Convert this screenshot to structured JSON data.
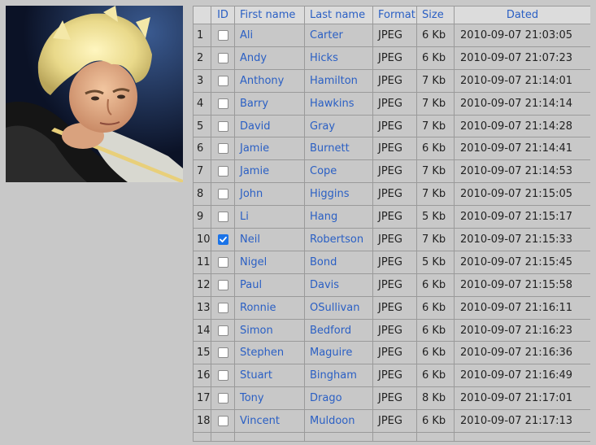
{
  "photo": {
    "subject": "snooker-player-photo"
  },
  "table": {
    "columns": [
      "",
      "ID",
      "First name",
      "Last name",
      "Format",
      "Size",
      "Dated"
    ],
    "rows": [
      {
        "num": "1",
        "checked": false,
        "first": "Ali",
        "last": "Carter",
        "format": "JPEG",
        "size": "6 Kb",
        "dated": "2010-09-07 21:03:05"
      },
      {
        "num": "2",
        "checked": false,
        "first": "Andy",
        "last": "Hicks",
        "format": "JPEG",
        "size": "6 Kb",
        "dated": "2010-09-07 21:07:23"
      },
      {
        "num": "3",
        "checked": false,
        "first": "Anthony",
        "last": "Hamilton",
        "format": "JPEG",
        "size": "7 Kb",
        "dated": "2010-09-07 21:14:01"
      },
      {
        "num": "4",
        "checked": false,
        "first": "Barry",
        "last": "Hawkins",
        "format": "JPEG",
        "size": "7 Kb",
        "dated": "2010-09-07 21:14:14"
      },
      {
        "num": "5",
        "checked": false,
        "first": "David",
        "last": "Gray",
        "format": "JPEG",
        "size": "7 Kb",
        "dated": "2010-09-07 21:14:28"
      },
      {
        "num": "6",
        "checked": false,
        "first": "Jamie",
        "last": "Burnett",
        "format": "JPEG",
        "size": "6 Kb",
        "dated": "2010-09-07 21:14:41"
      },
      {
        "num": "7",
        "checked": false,
        "first": "Jamie",
        "last": "Cope",
        "format": "JPEG",
        "size": "7 Kb",
        "dated": "2010-09-07 21:14:53"
      },
      {
        "num": "8",
        "checked": false,
        "first": "John",
        "last": "Higgins",
        "format": "JPEG",
        "size": "7 Kb",
        "dated": "2010-09-07 21:15:05"
      },
      {
        "num": "9",
        "checked": false,
        "first": "Li",
        "last": "Hang",
        "format": "JPEG",
        "size": "5 Kb",
        "dated": "2010-09-07 21:15:17"
      },
      {
        "num": "10",
        "checked": true,
        "first": "Neil",
        "last": "Robertson",
        "format": "JPEG",
        "size": "7 Kb",
        "dated": "2010-09-07 21:15:33"
      },
      {
        "num": "11",
        "checked": false,
        "first": "Nigel",
        "last": "Bond",
        "format": "JPEG",
        "size": "5 Kb",
        "dated": "2010-09-07 21:15:45"
      },
      {
        "num": "12",
        "checked": false,
        "first": "Paul",
        "last": "Davis",
        "format": "JPEG",
        "size": "6 Kb",
        "dated": "2010-09-07 21:15:58"
      },
      {
        "num": "13",
        "checked": false,
        "first": "Ronnie",
        "last": "OSullivan",
        "format": "JPEG",
        "size": "6 Kb",
        "dated": "2010-09-07 21:16:11"
      },
      {
        "num": "14",
        "checked": false,
        "first": "Simon",
        "last": "Bedford",
        "format": "JPEG",
        "size": "6 Kb",
        "dated": "2010-09-07 21:16:23"
      },
      {
        "num": "15",
        "checked": false,
        "first": "Stephen",
        "last": "Maguire",
        "format": "JPEG",
        "size": "6 Kb",
        "dated": "2010-09-07 21:16:36"
      },
      {
        "num": "16",
        "checked": false,
        "first": "Stuart",
        "last": "Bingham",
        "format": "JPEG",
        "size": "6 Kb",
        "dated": "2010-09-07 21:16:49"
      },
      {
        "num": "17",
        "checked": false,
        "first": "Tony",
        "last": "Drago",
        "format": "JPEG",
        "size": "8 Kb",
        "dated": "2010-09-07 21:17:01"
      },
      {
        "num": "18",
        "checked": false,
        "first": "Vincent",
        "last": "Muldoon",
        "format": "JPEG",
        "size": "6 Kb",
        "dated": "2010-09-07 21:17:13"
      }
    ]
  },
  "colors": {
    "link": "#2a5fc4",
    "background": "#c8c8c8",
    "header_bg": "#dcdcdc",
    "checkbox_checked": "#1a73e8"
  },
  "icons": {
    "checkbox_tick": "check-icon"
  }
}
